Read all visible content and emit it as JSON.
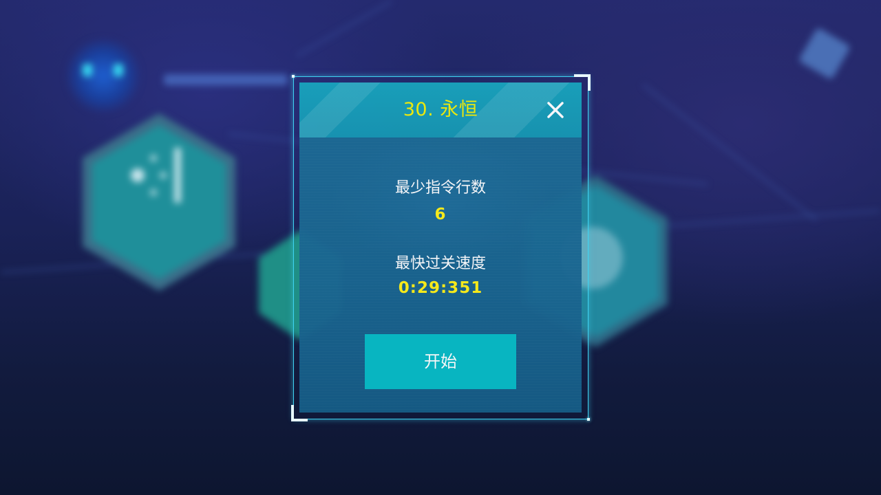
{
  "dialog": {
    "title": "30. 永恒",
    "stats": [
      {
        "label": "最少指令行数",
        "value": "6"
      },
      {
        "label": "最快过关速度",
        "value": "0:29:351"
      }
    ],
    "start_label": "开始",
    "close_icon": "close-icon"
  },
  "colors": {
    "title_text": "#f4f00a",
    "value_text": "#fff21a",
    "start_button": "#08bcc7",
    "frame_border": "#3fd3f2",
    "header_bg": "#19a3bd",
    "panel_bg": "#1a6590"
  },
  "background": {
    "style": "blurred level-select map",
    "icons": [
      "robot-icon",
      "level-node-hexagon",
      "level-node-hexagon",
      "level-node-hexagon",
      "diamond-icon"
    ]
  }
}
